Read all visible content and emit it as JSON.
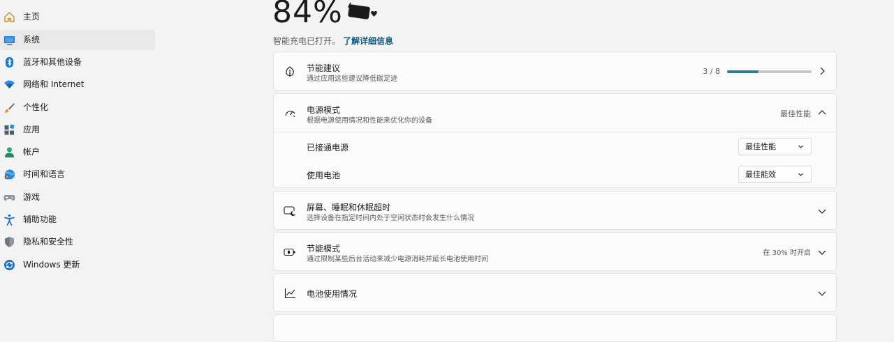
{
  "colors": {
    "accent": "#2c7d8f",
    "link": "#0f5a7f",
    "selected_bg": "#e9e9e9"
  },
  "sidebar": {
    "items": [
      {
        "label": "主页",
        "icon": "home-icon"
      },
      {
        "label": "系统",
        "icon": "system-display-icon",
        "selected": true
      },
      {
        "label": "蓝牙和其他设备",
        "icon": "bluetooth-icon"
      },
      {
        "label": "网络和 Internet",
        "icon": "wifi-icon"
      },
      {
        "label": "个性化",
        "icon": "brush-icon"
      },
      {
        "label": "应用",
        "icon": "apps-icon"
      },
      {
        "label": "帐户",
        "icon": "account-icon"
      },
      {
        "label": "时间和语言",
        "icon": "time-language-icon"
      },
      {
        "label": "游戏",
        "icon": "gamepad-icon"
      },
      {
        "label": "辅助功能",
        "icon": "accessibility-icon"
      },
      {
        "label": "隐私和安全性",
        "icon": "shield-icon"
      },
      {
        "label": "Windows 更新",
        "icon": "windows-update-icon"
      }
    ]
  },
  "battery": {
    "percent_text": "84%",
    "smart_charge_text": "智能充电已打开。",
    "learn_more": "了解详细信息"
  },
  "cards": {
    "energy_recommendations": {
      "title": "节能建议",
      "desc": "通过应用这些建议降低碳足迹",
      "progress_text": "3 / 8",
      "progress": 0.375
    },
    "power_mode": {
      "title": "电源模式",
      "desc": "根据电源使用情况和性能来优化你的设备",
      "current": "最佳性能",
      "plugged_in_label": "已接通电源",
      "plugged_in_value": "最佳性能",
      "on_battery_label": "使用电池",
      "on_battery_value": "最佳能效"
    },
    "screen_sleep": {
      "title": "屏幕、睡眠和休眠超时",
      "desc": "选择设备在指定时间内处于空闲状态时会发生什么情况"
    },
    "energy_saver": {
      "title": "节能模式",
      "desc": "通过限制某些后台活动来减少电源消耗并延长电池使用时间",
      "status": "在 30% 时开启"
    },
    "battery_usage": {
      "title": "电池使用情况"
    }
  }
}
